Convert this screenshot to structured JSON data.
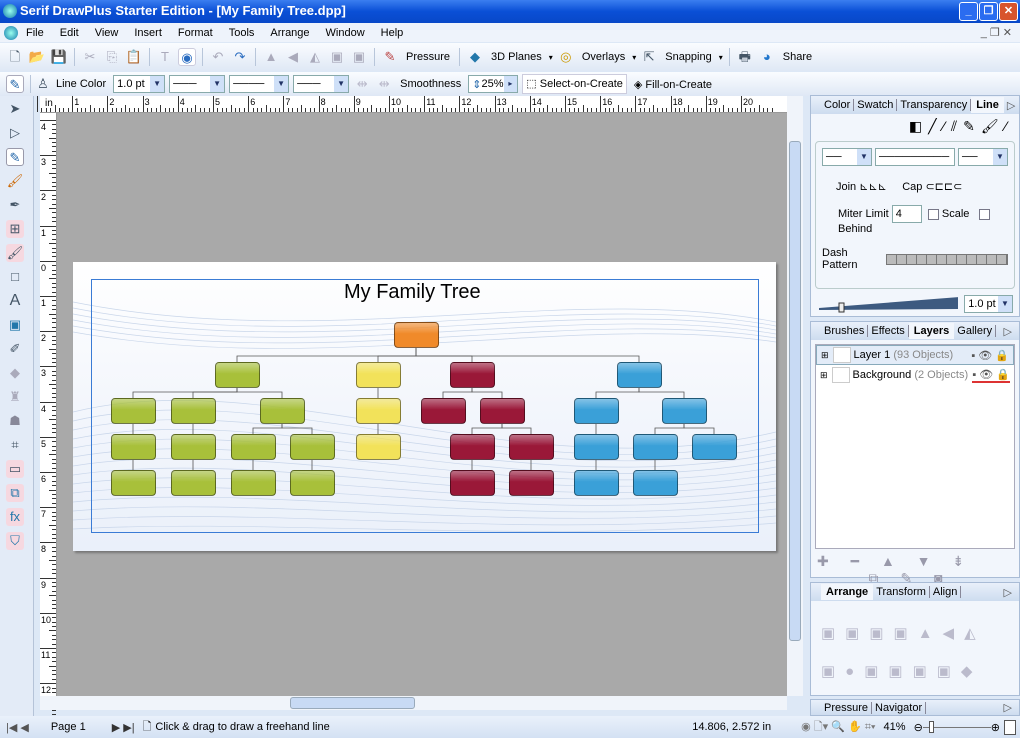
{
  "window": {
    "title": "Serif DrawPlus Starter Edition - [My Family Tree.dpp]"
  },
  "menu": [
    "File",
    "Edit",
    "View",
    "Insert",
    "Format",
    "Tools",
    "Arrange",
    "Window",
    "Help"
  ],
  "toolbar": {
    "pressure": "Pressure",
    "planes": "3D Planes",
    "overlays": "Overlays",
    "snapping": "Snapping",
    "share": "Share"
  },
  "context": {
    "line_color": "Line Color",
    "width": "1.0 pt",
    "smoothness": "Smoothness",
    "smoothness_value": "25%",
    "select_on_create": "Select-on-Create",
    "fill_on_create": "Fill-on-Create"
  },
  "rulers": {
    "unit": "in",
    "h": [
      "0",
      "1",
      "2",
      "3",
      "4",
      "5",
      "6",
      "7",
      "8",
      "9",
      "10",
      "11",
      "12",
      "13",
      "14",
      "15",
      "16",
      "17",
      "18",
      "19",
      "20"
    ],
    "v": [
      "4",
      "3",
      "2",
      "1",
      "0",
      "1",
      "2",
      "3",
      "4",
      "5",
      "6",
      "7",
      "8",
      "9",
      "10",
      "11",
      "12"
    ]
  },
  "document": {
    "title": "My Family Tree",
    "colors": {
      "orange": "#f08a2a",
      "green": "#a8c03a",
      "yellow": "#f2e25a",
      "maroon": "#9a1838",
      "blue": "#3aa0d8"
    }
  },
  "line_panel": {
    "tabs": [
      "Color",
      "Swatch",
      "Transparency",
      "Line"
    ],
    "active": "Line",
    "join": "Join",
    "cap": "Cap",
    "miter_label": "Miter Limit",
    "miter_value": "4",
    "scale": "Scale",
    "behind": "Behind",
    "dash": "Dash Pattern",
    "width": "1.0 pt"
  },
  "layers_panel": {
    "tabs": [
      "Brushes",
      "Effects",
      "Layers",
      "Gallery"
    ],
    "active": "Layers",
    "layers": [
      {
        "name": "Layer 1",
        "count": "(93 Objects)"
      },
      {
        "name": "Background",
        "count": "(2 Objects)"
      }
    ]
  },
  "arrange_panel": {
    "tabs": [
      "Arrange",
      "Transform",
      "Align"
    ],
    "active": "Arrange"
  },
  "nav_panel": {
    "tabs": [
      "Pressure",
      "Navigator"
    ]
  },
  "status": {
    "page": "Page 1",
    "hint": "Click & drag to draw a freehand line",
    "coords": "14.806,  2.572 in",
    "zoom": "41%"
  }
}
